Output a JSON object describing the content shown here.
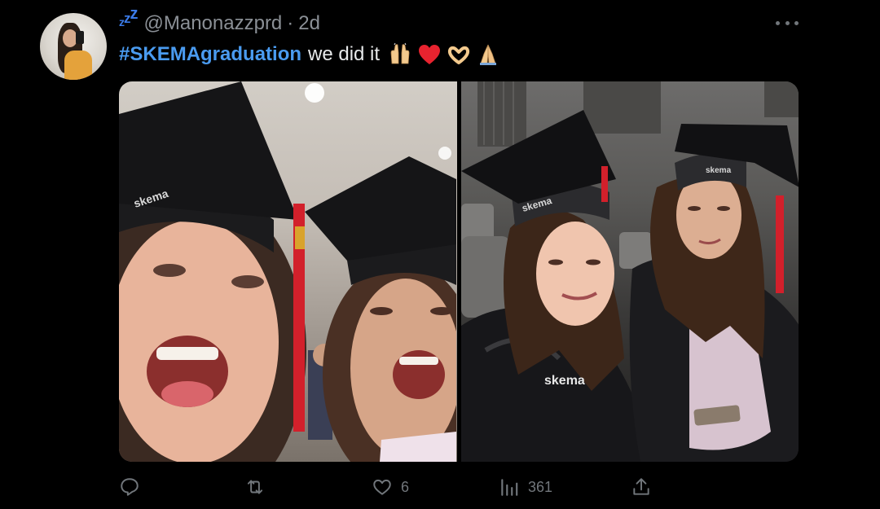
{
  "tweet": {
    "handle": "@Manonazzprd",
    "separator": "·",
    "time": "2d",
    "status_icon": "zzz-sleeping-icon",
    "hashtag": "#SKEMAgraduation",
    "text": "we did it",
    "emojis": [
      "raising-hands-emoji",
      "red-heart-emoji",
      "heart-hands-emoji",
      "folded-hands-emoji"
    ]
  },
  "media": {
    "photos": [
      "selfie-graduates-left",
      "graduates-seated-right"
    ],
    "cap_logo_text": "skema"
  },
  "actions": {
    "reply": {
      "icon": "reply-icon",
      "count": ""
    },
    "retweet": {
      "icon": "retweet-icon",
      "count": ""
    },
    "like": {
      "icon": "heart-icon",
      "count": "6"
    },
    "views": {
      "icon": "views-icon",
      "count": "361"
    },
    "share": {
      "icon": "share-icon",
      "count": ""
    }
  },
  "colors": {
    "background": "#000000",
    "hashtag": "#4a9bf0",
    "muted": "#71767b",
    "text": "#e7e9ea",
    "status_icon": "#3b7be8"
  }
}
